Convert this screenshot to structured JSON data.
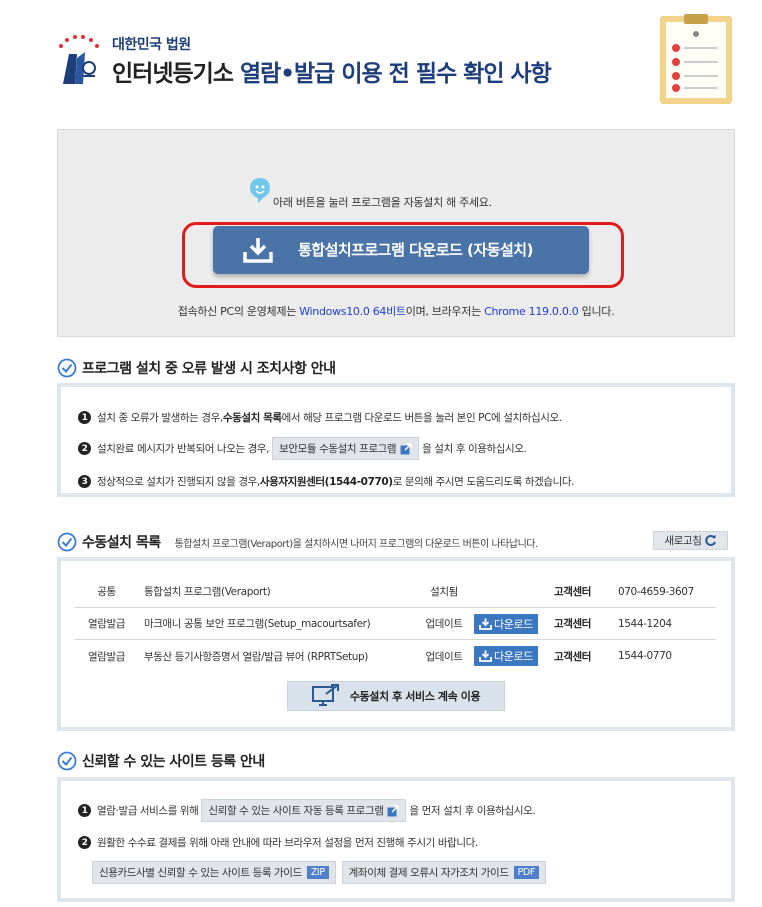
{
  "header": {
    "court_name": "대한민국 법원",
    "title_prefix": "인터넷등기소",
    "title_highlight": "열람•발급 이용 전 필수 확인 사항"
  },
  "install": {
    "message": "아래 버튼을 눌러 프로그램을 자동설치 해 주세요.",
    "download_label": "통합설치프로그램 다운로드 (자동설치)",
    "env_prefix": "접속하신 PC의 운영체제는 ",
    "os": "Windows10.0 64비트",
    "env_mid": "이며, 브라우저는 ",
    "browser": "Chrome 119.0.0.0",
    "env_suffix": " 입니다."
  },
  "error_section": {
    "title": "프로그램 설치 중 오류 발생 시 조치사항 안내",
    "items": [
      {
        "num": "1",
        "pre": "설치 중 오류가 발생하는 경우, ",
        "bold": "수동설치 목록",
        "post": "에서 해당 프로그램 다운로드 버튼을 눌러 본인 PC에 설치하십시오."
      },
      {
        "num": "2",
        "pre": "설치완료 메시지가 반복되어 나오는 경우, ",
        "button": "보안모듈 수동설치 프로그램",
        "post": "을 설치 후 이용하십시오."
      },
      {
        "num": "3",
        "pre": "정상적으로 설치가 진행되지 않을 경우, ",
        "bold": "사용자지원센터(1544-0770)",
        "post": "로 문의해 주시면 도움드리도록 하겠습니다."
      }
    ]
  },
  "manual": {
    "title": "수동설치 목록",
    "subtitle": "통합설치 프로그램(Veraport)을 설치하시면 나머지 프로그램의 다운로드 버튼이 나타납니다.",
    "refresh_label": "새로고침",
    "rows": [
      {
        "category": "공통",
        "name": "통합설치 프로그램(Veraport)",
        "status": "설치됨",
        "download": "",
        "center_label": "고객센터",
        "phone": "070-4659-3607"
      },
      {
        "category": "열람발급",
        "name": "마크애니 공통 보안 프로그램(Setup_macourtsafer)",
        "status": "업데이트",
        "download": "다운로드",
        "center_label": "고객센터",
        "phone": "1544-1204"
      },
      {
        "category": "열람발급",
        "name": "부동산 등기사항증명서 열람/발급 뷰어 (RPRTSetup)",
        "status": "업데이트",
        "download": "다운로드",
        "center_label": "고객센터",
        "phone": "1544-0770"
      }
    ],
    "continue_label": "수동설치 후 서비스 계속 이용"
  },
  "trust": {
    "title": "신뢰할 수 있는 사이트 등록 안내",
    "item1_pre": "열람·발급 서비스를 위해 ",
    "item1_button": "신뢰할 수 있는 사이트 자동 등록 프로그램",
    "item1_post": " 을 먼저 설치 후 이용하십시오.",
    "item2": "원활한 수수료 결제를 위해 아래 안내에 따라 브라우저 설정을 먼저 진행해 주시기 바랍니다.",
    "guide1_label": "신용카드사별 신뢰할 수 있는 사이트 등록 가이드",
    "guide1_badge": "ZIP",
    "guide2_label": "계좌이체 결제 오류시 자가조치 가이드",
    "guide2_badge": "PDF"
  },
  "colors": {
    "accent": "#4a74a7",
    "highlight_red": "#e01b1b",
    "link_blue": "#1f3fcf",
    "title_navy": "#1d3e7a"
  }
}
